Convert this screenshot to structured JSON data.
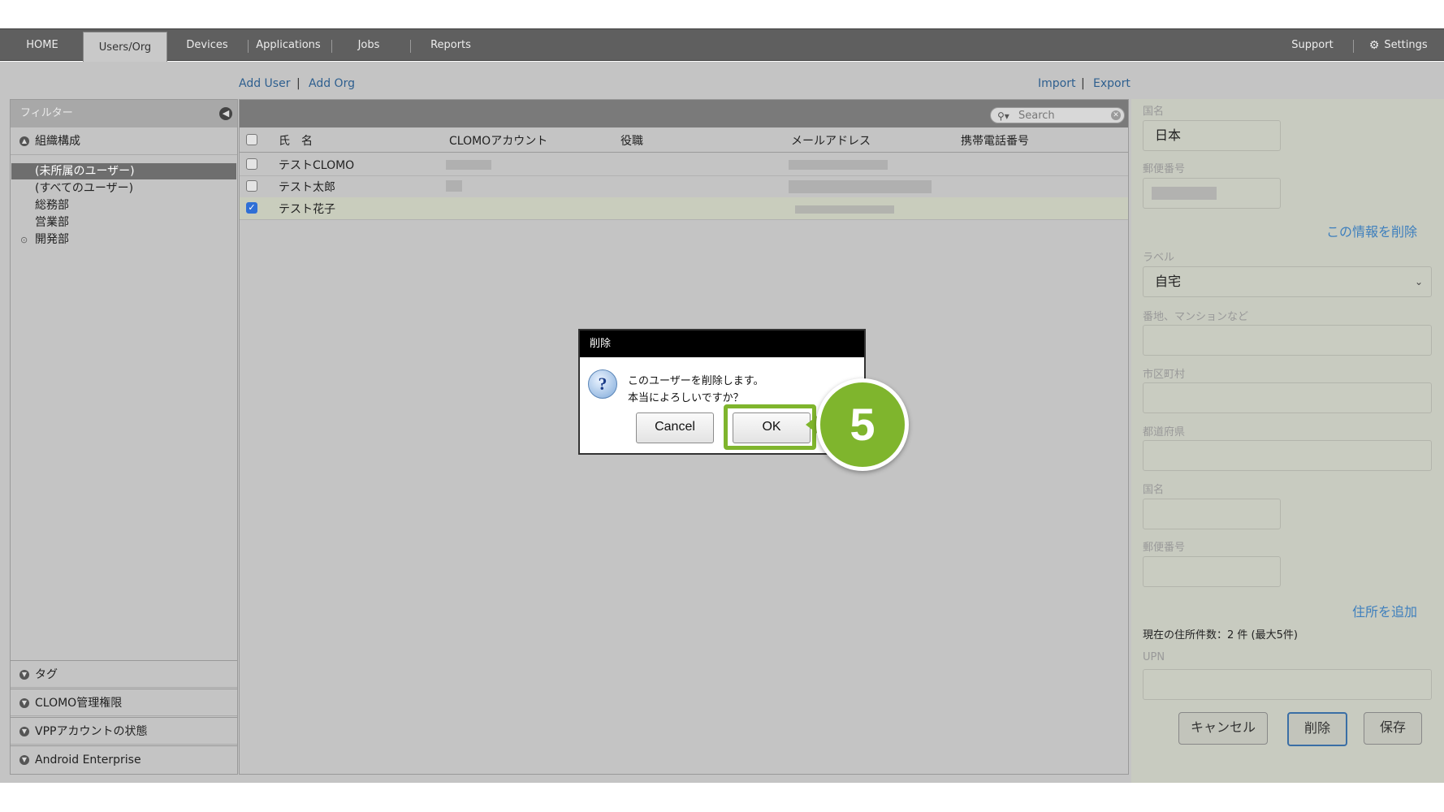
{
  "nav": {
    "tabs": [
      "HOME",
      "Users/Org",
      "Devices",
      "Applications",
      "Jobs",
      "Reports"
    ],
    "active_tab": "Users/Org",
    "support": "Support",
    "settings": "Settings"
  },
  "actions": {
    "add_user": "Add User",
    "add_org": "Add Org",
    "import": "Import",
    "export": "Export"
  },
  "sidebar": {
    "filter_title": "フィルター",
    "org_section": "組織構成",
    "tree": [
      "(未所属のユーザー)",
      "(すべてのユーザー)",
      "総務部",
      "営業部",
      "開発部"
    ],
    "selected_index": 0,
    "bottom_sections": [
      "タグ",
      "CLOMO管理権限",
      "VPPアカウントの状態",
      "Android Enterprise"
    ]
  },
  "table": {
    "search_placeholder": "Search",
    "columns": [
      "氏　名",
      "CLOMOアカウント",
      "役職",
      "メールアドレス",
      "携帯電話番号"
    ],
    "rows": [
      {
        "name": "テストCLOMO",
        "checked": false
      },
      {
        "name": "テスト太郎",
        "checked": false
      },
      {
        "name": "テスト花子",
        "checked": true
      }
    ]
  },
  "right_panel": {
    "country_label_1": "国名",
    "country_value_1": "日本",
    "postal_label_1": "郵便番号",
    "delete_info_link": "この情報を削除",
    "label_label": "ラベル",
    "label_value": "自宅",
    "street_label": "番地、マンションなど",
    "city_label": "市区町村",
    "prefecture_label": "都道府県",
    "country_label_2": "国名",
    "postal_label_2": "郵便番号",
    "add_address_link": "住所を追加",
    "address_count": "現在の住所件数：2 件 (最大5件)",
    "upn_label": "UPN",
    "cancel_btn": "キャンセル",
    "delete_btn": "削除",
    "save_btn": "保存"
  },
  "dialog": {
    "title": "削除",
    "message_line1": "このユーザーを削除します。",
    "message_line2": "本当によろしいですか？",
    "cancel": "Cancel",
    "ok": "OK"
  },
  "step_badge": "5",
  "colors": {
    "highlight": "#7fb52d",
    "link": "#2e5f8f",
    "nav_bg": "#5f5f5f",
    "checkbox_on": "#2f6fd6"
  }
}
